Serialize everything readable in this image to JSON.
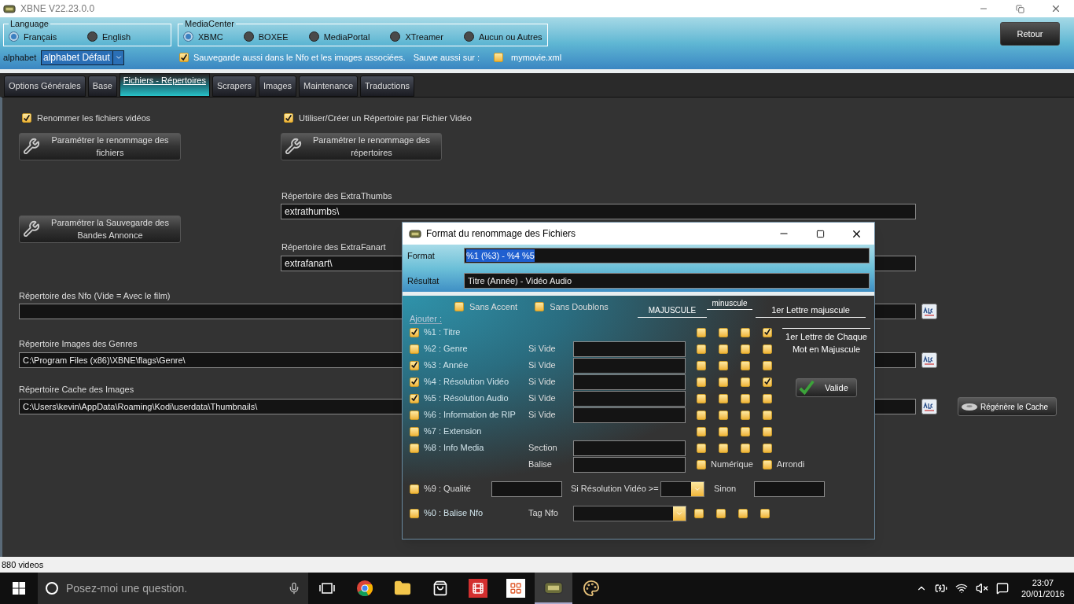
{
  "window": {
    "title": "XBNE V22.23.0.0"
  },
  "language": {
    "label": "Language",
    "options": [
      {
        "label": "Français",
        "selected": true
      },
      {
        "label": "English",
        "selected": false
      }
    ]
  },
  "media_center": {
    "label": "MediaCenter",
    "options": [
      {
        "label": "XBMC",
        "selected": true
      },
      {
        "label": "BOXEE",
        "selected": false
      },
      {
        "label": "MediaPortal",
        "selected": false
      },
      {
        "label": "XTreamer",
        "selected": false
      },
      {
        "label": "Aucun ou Autres",
        "selected": false
      }
    ]
  },
  "alphabet": {
    "label": "alphabet",
    "value": "alphabet Défaut"
  },
  "save_nfo": {
    "label": "Sauvegarde aussi dans le Nfo et les images associées.",
    "checked": true
  },
  "save_also": {
    "label": "Sauve aussi sur :",
    "option": "mymovie.xml",
    "checked": false
  },
  "back_button": "Retour",
  "tabs": [
    {
      "label": "Options Générales",
      "selected": false
    },
    {
      "label": "Base",
      "selected": false
    },
    {
      "label": "Fichiers - Répertoires",
      "selected": true
    },
    {
      "label": "Scrapers",
      "selected": false
    },
    {
      "label": "Images",
      "selected": false
    },
    {
      "label": "Maintenance",
      "selected": false
    },
    {
      "label": "Traductions",
      "selected": false
    }
  ],
  "rename_files": {
    "label": "Renommer les fichiers vidéos",
    "checked": true,
    "button": "Paramétrer le renommage des fichiers"
  },
  "rename_dirs": {
    "label": "Utiliser/Créer un Répertoire par Fichier Vidéo",
    "checked": true,
    "button": "Paramétrer le renommage des répertoires"
  },
  "trailer_button": "Paramétrer la Sauvegarde des Bandes Annonce",
  "extrathumbs": {
    "label": "Répertoire des ExtraThumbs",
    "value": "extrathumbs\\"
  },
  "extrafanart": {
    "label": "Répertoire des ExtraFanart",
    "value": "extrafanart\\"
  },
  "nfo_dir": {
    "label": "Répertoire des Nfo (Vide = Avec le film)"
  },
  "genres_dir": {
    "label": "Répertoire Images des Genres",
    "value": "C:\\Program Files (x86)\\XBNE\\flags\\Genre\\"
  },
  "cache_dir": {
    "label": "Répertoire Cache des Images",
    "value": "C:\\Users\\kevin\\AppData\\Roaming\\Kodi\\userdata\\Thumbnails\\"
  },
  "regen_button": "Régénère le Cache",
  "status_bar": "880 videos",
  "dialog": {
    "title": "Format du renommage des Fichiers",
    "format": {
      "label": "Format",
      "value": "%1 (%3) - %4 %5"
    },
    "result": {
      "label": "Résultat",
      "value": "Titre (Année) - Vidéo Audio"
    },
    "add_label": "Ajouter :",
    "options": [
      {
        "label": "Sans Accent",
        "checked": false
      },
      {
        "label": "Sans Doublons",
        "checked": false
      }
    ],
    "case_headers": {
      "upper": "MAJUSCULE",
      "lower": "minuscule",
      "first": "1er Lettre majuscule",
      "each_word": "1er Lettre de Chaque Mot en Majuscule"
    },
    "fields": [
      {
        "kind": "plain",
        "label": "%1 : Titre",
        "checked": true,
        "cases": [
          {
            "checked": false
          },
          {
            "checked": false
          },
          {
            "checked": false
          },
          {
            "checked": true
          }
        ]
      },
      {
        "kind": "if_empty",
        "label": "%2 : Genre",
        "checked": false,
        "sub_label": "Si Vide",
        "cases": [
          {
            "checked": false
          },
          {
            "checked": false
          },
          {
            "checked": false
          },
          {
            "checked": false
          }
        ]
      },
      {
        "kind": "if_empty",
        "label": "%3 : Année",
        "checked": true,
        "sub_label": "Si Vide",
        "cases": [
          {
            "checked": false
          },
          {
            "checked": false
          },
          {
            "checked": false
          },
          {
            "checked": false
          }
        ]
      },
      {
        "kind": "if_empty",
        "label": "%4 : Résolution Vidéo",
        "checked": true,
        "sub_label": "Si Vide",
        "cases": [
          {
            "checked": false
          },
          {
            "checked": false
          },
          {
            "checked": false
          },
          {
            "checked": true
          }
        ]
      },
      {
        "kind": "if_empty",
        "label": "%5 : Résolution Audio",
        "checked": true,
        "sub_label": "Si Vide",
        "cases": [
          {
            "checked": false
          },
          {
            "checked": false
          },
          {
            "checked": false
          },
          {
            "checked": false
          }
        ]
      },
      {
        "kind": "if_empty",
        "label": "%6 : Information de RIP",
        "checked": false,
        "sub_label": "Si Vide",
        "cases": [
          {
            "checked": false
          },
          {
            "checked": false
          },
          {
            "checked": false
          },
          {
            "checked": false
          }
        ]
      },
      {
        "kind": "plain",
        "label": "%7 : Extension",
        "checked": false,
        "cases": [
          {
            "checked": false
          },
          {
            "checked": false
          },
          {
            "checked": false
          },
          {
            "checked": false
          }
        ]
      },
      {
        "kind": "media",
        "label": "%8 : Info Media",
        "checked": false,
        "sub_label": "Section",
        "second_label": "Balise",
        "numeric": {
          "label": "Numérique",
          "checked": false
        },
        "rounded": {
          "label": "Arrondi",
          "checked": false
        },
        "cases": [
          {
            "checked": false
          },
          {
            "checked": false
          },
          {
            "checked": false
          },
          {
            "checked": false
          }
        ]
      },
      {
        "kind": "quality",
        "label": "%9 : Qualité",
        "checked": false,
        "condition_label": "Si Résolution Vidéo >=",
        "else_label": "Sinon"
      },
      {
        "kind": "tag",
        "label": "%0 : Balise Nfo",
        "checked": false,
        "sub_label": "Tag Nfo",
        "cases": [
          {
            "checked": false
          },
          {
            "checked": false
          },
          {
            "checked": false
          },
          {
            "checked": false
          }
        ]
      }
    ],
    "valid_button": "Valide"
  },
  "taskbar": {
    "search_placeholder": "Posez-moi une question.",
    "time": "23:07",
    "date": "20/01/2016"
  }
}
